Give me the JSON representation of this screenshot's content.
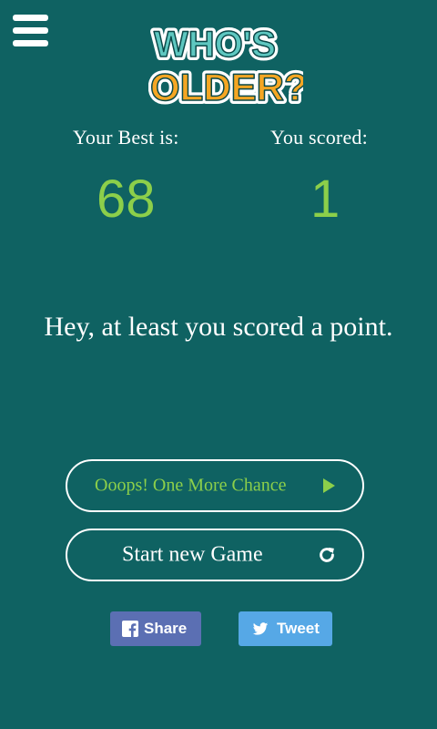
{
  "header": {
    "menu_icon": "hamburger-menu-icon",
    "logo": {
      "line1": "WHO'S",
      "line2": "OLDER?",
      "colors": {
        "line1": "#5ec7c0",
        "line2": "#f5a623",
        "outline": "#ffffff",
        "shadow": "#0a4848"
      }
    }
  },
  "scores": {
    "best_label": "Your Best is:",
    "best_value": "68",
    "current_label": "You scored:",
    "current_value": "1"
  },
  "message": "Hey, at least you scored a point.",
  "actions": {
    "more_chance_label": "Ooops! One More Chance",
    "more_chance_icon": "play-icon",
    "new_game_label": "Start new Game",
    "new_game_icon": "refresh-icon"
  },
  "social": {
    "share_label": "Share",
    "share_icon": "facebook-icon",
    "tweet_label": "Tweet",
    "tweet_icon": "twitter-bird-icon"
  },
  "colors": {
    "background": "#0f6262",
    "accent_green": "#8ccf4a",
    "facebook": "#5b6fb3",
    "twitter": "#56a8e6"
  }
}
